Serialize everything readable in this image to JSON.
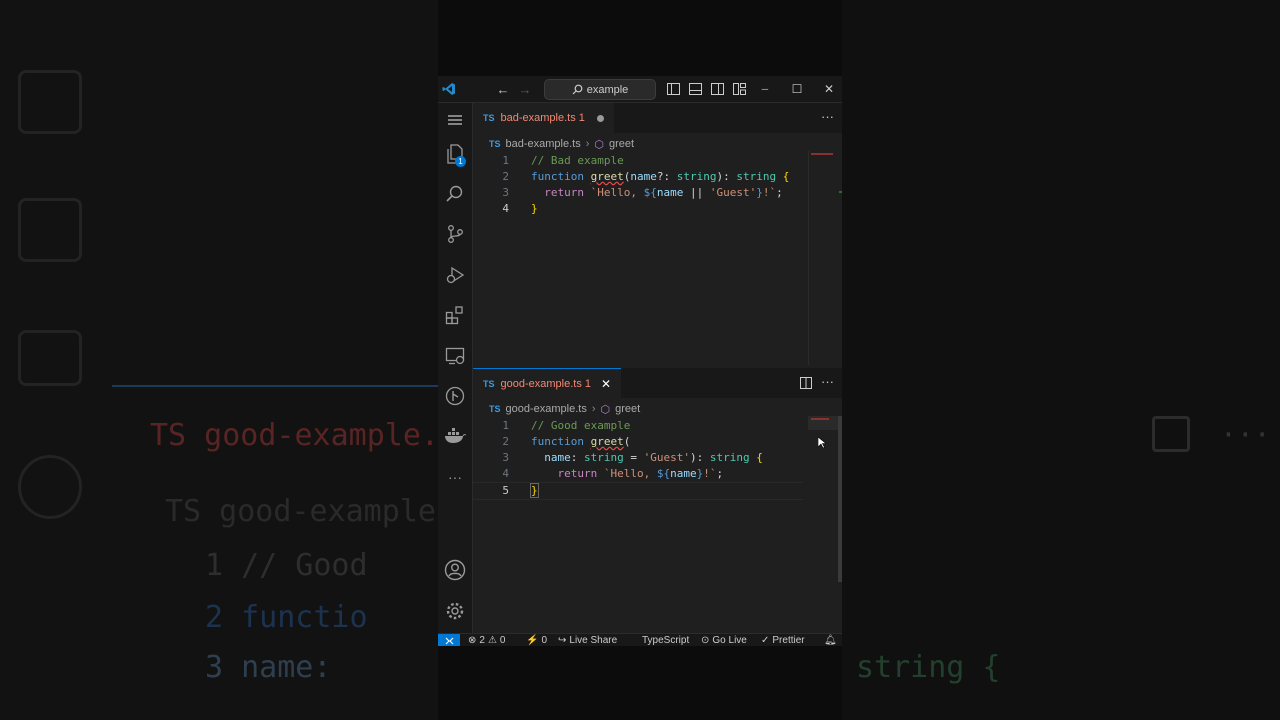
{
  "window": {
    "search_text": "example",
    "minimize_glyph": "─",
    "maximize_glyph": "☐",
    "close_glyph": "✕"
  },
  "activity_bar": {
    "explorer_badge": "1"
  },
  "top_editor": {
    "tab_lang": "TS",
    "tab_label": "bad-example.ts 1",
    "crumb_file": "bad-example.ts",
    "crumb_symbol": "greet",
    "line_numbers": [
      "1",
      "2",
      "3",
      "4"
    ]
  },
  "bottom_editor": {
    "tab_lang": "TS",
    "tab_label": "good-example.ts 1",
    "crumb_file": "good-example.ts",
    "crumb_symbol": "greet",
    "line_numbers": [
      "1",
      "2",
      "3",
      "4",
      "5"
    ]
  },
  "status_bar": {
    "errors": "2",
    "warnings": "0",
    "ports": "0",
    "live_share": "Live Share",
    "language": "TypeScript",
    "go_live": "Go Live",
    "prettier": "Prettier"
  },
  "colors": {
    "accent": "#0078d4",
    "tab_modified": "#e2c08d",
    "error_tab": "#f48771"
  }
}
